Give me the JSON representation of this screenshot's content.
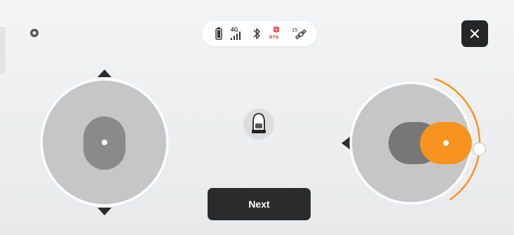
{
  "status_bar": {
    "icons": [
      "battery-icon",
      "cellular-signal-icon",
      "bluetooth-icon",
      "rtk-icon",
      "satellite-icon"
    ],
    "signal_label": "4G",
    "rtk_label": "RTK",
    "satellite_count": "15"
  },
  "actions": {
    "close_icon": "close-icon",
    "next_label": "Next"
  },
  "left_joystick": {
    "direction": "vertical"
  },
  "right_joystick": {
    "direction": "horizontal",
    "level": 0.85
  },
  "colors": {
    "accent": "#f7931e",
    "rtk_red": "#e0322a",
    "dark_button": "#2b2b2b",
    "joystick_base": "#c6c6c6",
    "joystick_knob": "#8a8a8a"
  }
}
